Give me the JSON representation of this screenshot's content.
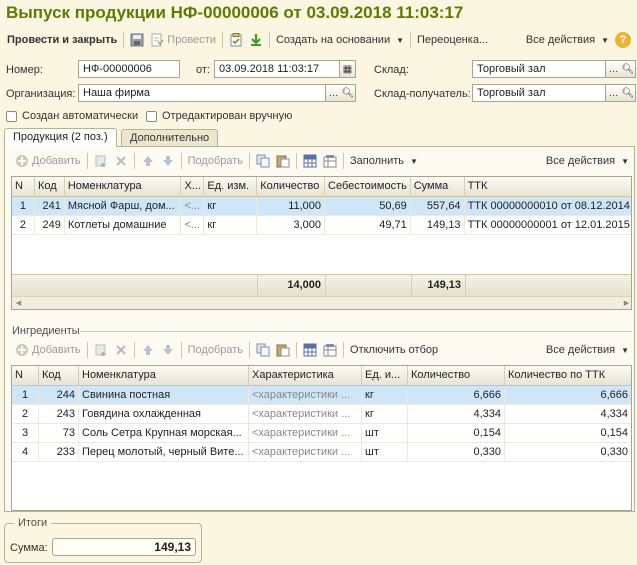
{
  "title": "Выпуск продукции НФ-00000006 от 03.09.2018 11:03:17",
  "toolbar": {
    "post_close": "Провести и закрыть",
    "post": "Провести",
    "create_based": "Создать на основании",
    "revalue": "Переоценка...",
    "all_actions": "Все действия",
    "help": "?"
  },
  "form": {
    "number_label": "Номер:",
    "number_value": "НФ-00000006",
    "date_label": "от:",
    "date_value": "03.09.2018 11:03:17",
    "warehouse_label": "Склад:",
    "warehouse_value": "Торговый зал",
    "org_label": "Организация:",
    "org_value": "Наша фирма",
    "recv_label": "Склад-получатель:",
    "recv_value": "Торговый зал",
    "auto_created": "Создан автоматически",
    "manual_edit": "Отредактирован вручную"
  },
  "tabs": [
    "Продукция (2 поз.)",
    "Дополнительно"
  ],
  "products_toolbar": {
    "add": "Добавить",
    "pick": "Подобрать",
    "fill": "Заполнить",
    "all_actions": "Все действия"
  },
  "products": {
    "columns": [
      "N",
      "Код",
      "Номенклатура",
      "Х...",
      "Ед. изм.",
      "Количество",
      "Себестоимость",
      "Сумма",
      "ТТК"
    ],
    "rows": [
      {
        "n": "1",
        "code": "241",
        "name": "Мясной Фарш, дом...",
        "x": "<...",
        "unit": "кг",
        "qty": "11,000",
        "cost": "50,69",
        "sum": "557,64",
        "ttk": "ТТК 00000000010 от 08.12.2014"
      },
      {
        "n": "2",
        "code": "249",
        "name": "Котлеты домашние",
        "x": "<...",
        "unit": "кг",
        "qty": "3,000",
        "cost": "49,71",
        "sum": "149,13",
        "ttk": "ТТК 00000000001 от 12.01.2015"
      }
    ],
    "total_qty": "14,000",
    "total_sum": "149,13"
  },
  "ingredients_title": "Ингредиенты",
  "ingredients_toolbar": {
    "add": "Добавить",
    "pick": "Подобрать",
    "disable_filter": "Отключить отбор",
    "all_actions": "Все действия"
  },
  "ingredients": {
    "columns": [
      "N",
      "Код",
      "Номенклатура",
      "Характеристика",
      "Ед. и...",
      "Количество",
      "Количество по ТТК"
    ],
    "rows": [
      {
        "n": "1",
        "code": "244",
        "name": "Свинина постная",
        "char": "<характеристики ...",
        "unit": "кг",
        "qty": "6,666",
        "qty_ttk": "6,666"
      },
      {
        "n": "2",
        "code": "243",
        "name": "Говядина охлажденная",
        "char": "<характеристики ...",
        "unit": "кг",
        "qty": "4,334",
        "qty_ttk": "4,334"
      },
      {
        "n": "3",
        "code": "73",
        "name": "Соль Сетра Крупная морская...",
        "char": "<характеристики ...",
        "unit": "шт",
        "qty": "0,154",
        "qty_ttk": "0,154"
      },
      {
        "n": "4",
        "code": "233",
        "name": "Перец молотый, черный Вите...",
        "char": "<характеристики ...",
        "unit": "шт",
        "qty": "0,330",
        "qty_ttk": "0,330"
      }
    ]
  },
  "totals": {
    "title": "Итоги",
    "sum_label": "Сумма:",
    "sum_value": "149,13"
  }
}
